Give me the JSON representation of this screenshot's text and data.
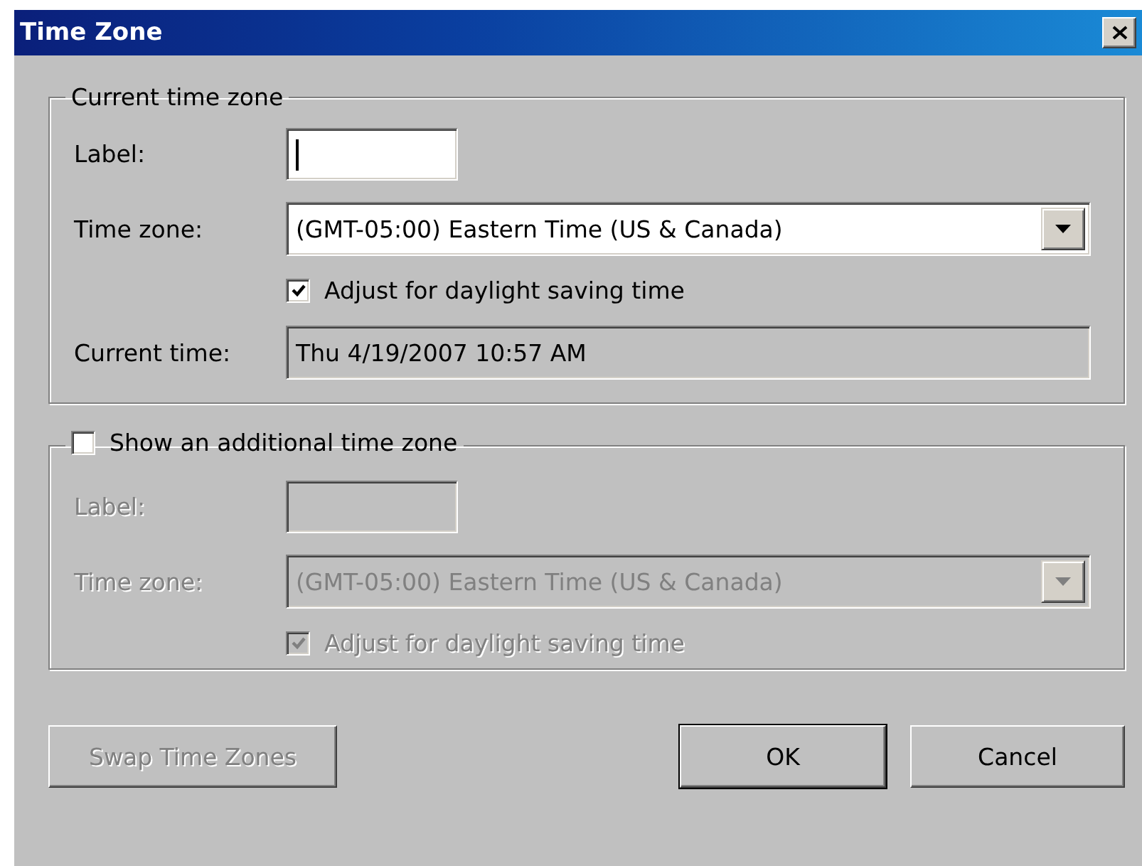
{
  "window": {
    "title": "Time Zone"
  },
  "groups": [
    {
      "kind": "plain",
      "legend": "Current time zone",
      "disabled": false,
      "fields": [
        {
          "kind": "input",
          "label": "Label:",
          "focused": true
        },
        {
          "kind": "select",
          "label": "Time zone:",
          "value": "(GMT-05:00) Eastern Time (US & Canada)"
        },
        {
          "kind": "checkbox",
          "label": "Adjust for daylight saving time",
          "checked": true
        },
        {
          "kind": "readonly",
          "label": "Current time:",
          "value": "Thu 4/19/2007 10:57 AM"
        }
      ]
    },
    {
      "kind": "checkable",
      "legend": "Show an additional time zone",
      "checked": false,
      "disabled": true,
      "fields": [
        {
          "kind": "input",
          "label": "Label:",
          "focused": false
        },
        {
          "kind": "select",
          "label": "Time zone:",
          "value": "(GMT-05:00) Eastern Time (US & Canada)"
        },
        {
          "kind": "checkbox",
          "label": "Adjust for daylight saving time",
          "checked": true
        }
      ]
    }
  ],
  "buttons": [
    {
      "label": "Swap Time Zones",
      "disabled": true,
      "default": false
    },
    {
      "label": "OK",
      "disabled": false,
      "default": true
    },
    {
      "label": "Cancel",
      "disabled": false,
      "default": false
    }
  ]
}
